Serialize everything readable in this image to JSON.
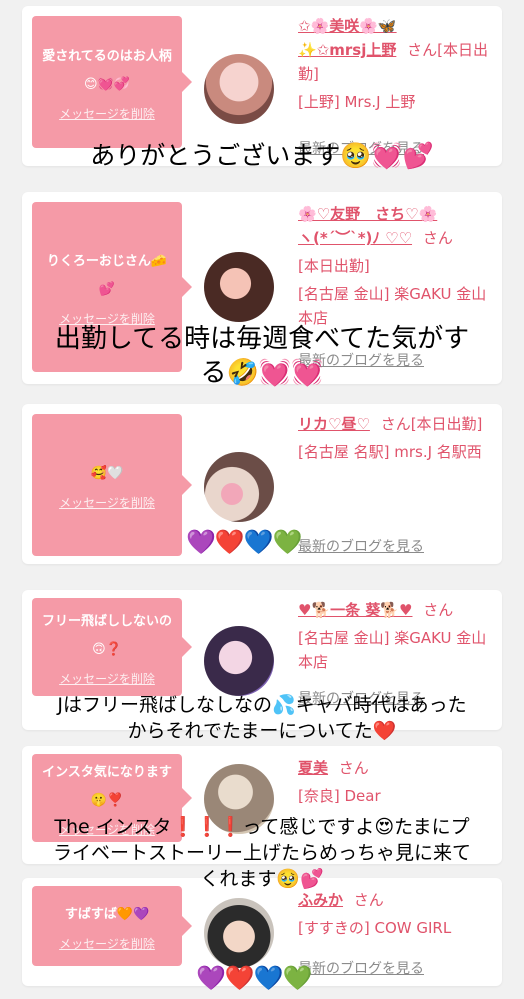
{
  "entries": [
    {
      "message": "愛されてるのはお人柄😊💓💞",
      "delete_label": "メッセージを削除",
      "name_line1": "✩🌸美咲🌸🦋",
      "name_line2": "✨✩mrsj上野",
      "honorific": "さん",
      "status": "[本日出勤]",
      "shop": "[上野] Mrs.J 上野",
      "blog_link": "最新のブログを見る"
    },
    {
      "message": "りくろーおじさん🧀💕",
      "delete_label": "メッセージを削除",
      "name_line1": "🌸♡友野　さち♡🌸",
      "name_line2": "ヽ(*´︶`*)ﾉ ♡♡",
      "honorific": "さん",
      "status": "[本日出勤]",
      "shop": "[名古屋 金山] 楽GAKU 金山本店",
      "blog_link": "最新のブログを見る"
    },
    {
      "message": "🥰🤍",
      "delete_label": "メッセージを削除",
      "name_line1": "リカ♡昼♡",
      "honorific": "さん",
      "status": "[本日出勤]",
      "shop": "[名古屋 名駅] mrs.J 名駅西",
      "blog_link": "最新のブログを見る"
    },
    {
      "message": "フリー飛ばししないの🙃❓",
      "delete_label": "メッセージを削除",
      "name_line1": "♥🐕一条 葵🐕♥",
      "honorific": "さん",
      "shop": "[名古屋 金山] 楽GAKU 金山本店",
      "blog_link": "最新のブログを見る"
    },
    {
      "message": "インスタ気になります🤫❣️",
      "delete_label": "メッセージを削除",
      "name_line1": "夏美",
      "honorific": "さん",
      "shop": "[奈良] Dear",
      "blog_link": "最新のブログを見る"
    },
    {
      "message": "すばすば🧡💜",
      "delete_label": "メッセージを削除",
      "name_line1": "ふみか",
      "honorific": "さん",
      "shop": "[すすきの] COW GIRL",
      "blog_link": "最新のブログを見る"
    }
  ],
  "captions": {
    "c1": "ありがとうございます🥹💓💕",
    "c2a": "出勤してる時は毎週食べてた気がす",
    "c2b": "る🤣💓💓",
    "c3a": "Jはフリー飛ばしなしなの💦キャバ時代はあった",
    "c3b": "からそれでたまーについてた❤️",
    "c4a": "The インスタ❗️❗️❗️って感じですよ😍たまにプ",
    "c4b": "ライベートストーリー上げたらめっちゃ見に来て",
    "c4c": "くれます🥹💕"
  },
  "heart_stickers": [
    "💜",
    "❤️",
    "💙",
    "💚"
  ],
  "colors": {
    "bubble": "#f59aa7",
    "accent_text": "#e0536b",
    "link_gray": "#8b8b8b",
    "background": "#f1f1f1"
  }
}
